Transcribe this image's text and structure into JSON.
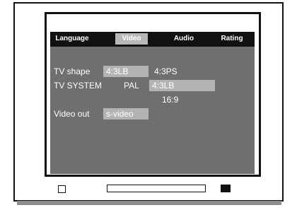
{
  "menu": {
    "tabs": [
      {
        "label": "Language"
      },
      {
        "label": "Video",
        "active": true
      },
      {
        "label": "Audio"
      },
      {
        "label": "Rating"
      }
    ]
  },
  "settings": {
    "tv_shape": {
      "label": "TV shape",
      "selected": "4:3LB",
      "option": "4:3PS"
    },
    "tv_system": {
      "label": "TV SYSTEM",
      "value": "PAL",
      "highlighted": "4:3LB",
      "option": "16:9"
    },
    "video_out": {
      "label": "Video out",
      "selected": "s-video"
    }
  },
  "colors": {
    "menu_bar": "#111111",
    "osd_background": "#6f6f6f",
    "highlight": "#b3b3b3"
  }
}
